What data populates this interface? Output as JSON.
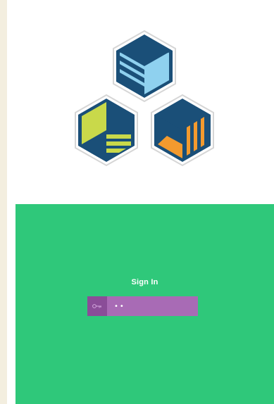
{
  "signin": {
    "title": "Sign In",
    "password_value": "••",
    "key_icon": "key-icon"
  },
  "colors": {
    "panel": "#2fc87a",
    "field": "#a86bb5",
    "key_box": "#8a4d98",
    "logo_navy": "#1a4f78",
    "logo_lightblue": "#8fd1ef",
    "logo_lime": "#c9d94a",
    "logo_orange": "#f39a2e",
    "left_rail": "#f3eedf"
  },
  "logo": {
    "icons": [
      "blue-cube-icon",
      "lime-cube-icon",
      "orange-cube-icon"
    ]
  }
}
